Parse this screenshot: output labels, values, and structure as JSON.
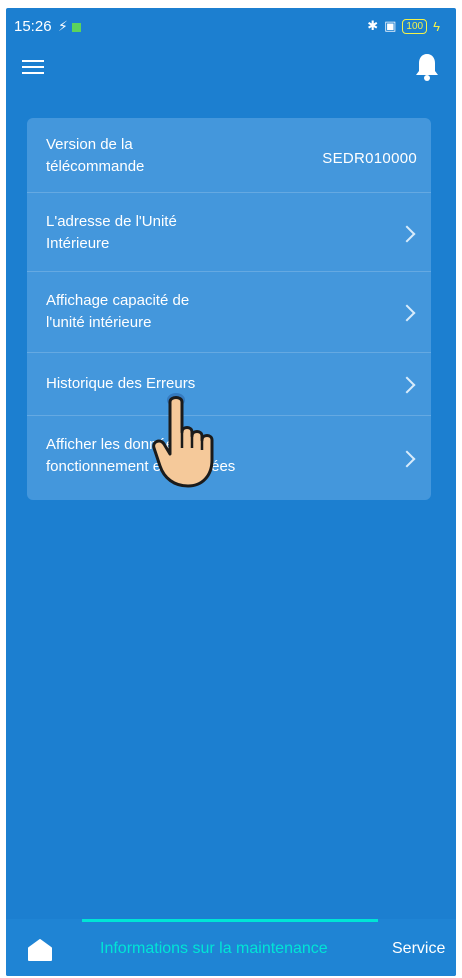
{
  "status_bar": {
    "time": "15:26",
    "battery": "100"
  },
  "list": {
    "items": [
      {
        "label_line1": "Version de la",
        "label_line2": "télécommande",
        "value": "SEDR010000"
      },
      {
        "label_line1": "L'adresse de l'Unité",
        "label_line2": "Intérieure"
      },
      {
        "label_line1": "Affichage capacité de",
        "label_line2": "l'unité intérieure"
      },
      {
        "label_line1": "Historique des Erreurs"
      },
      {
        "label_line1": "Afficher les données de",
        "label_line2": "fonctionnement enregistrées"
      }
    ]
  },
  "bottom_nav": {
    "active_tab": "Informations sur la maintenance",
    "next_tab": "Service"
  },
  "colors": {
    "background": "#1c7fd0",
    "card": "#4497dc",
    "accent": "#00e5d6"
  },
  "icons": [
    "menu-icon",
    "bell-icon",
    "chevron-right-icon",
    "home-icon",
    "pointing-hand-icon"
  ]
}
